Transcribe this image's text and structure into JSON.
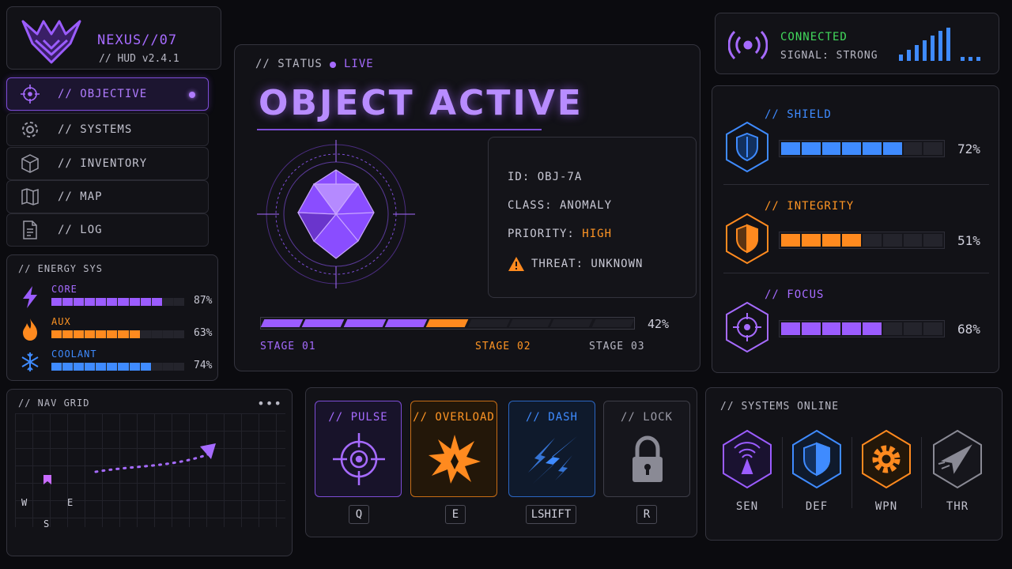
{
  "brand": {
    "title": "NEXUS//07",
    "version": "// HUD v2.4.1"
  },
  "nav": {
    "items": [
      {
        "label": "// OBJECTIVE",
        "icon": "crosshair-icon",
        "active": true
      },
      {
        "label": "// SYSTEMS",
        "icon": "gear-icon",
        "active": false
      },
      {
        "label": "// INVENTORY",
        "icon": "cube-icon",
        "active": false
      },
      {
        "label": "// MAP",
        "icon": "map-icon",
        "active": false
      },
      {
        "label": "// LOG",
        "icon": "document-icon",
        "active": false
      }
    ]
  },
  "energy": {
    "title": "// ENERGY SYS",
    "rows": [
      {
        "name": "CORE",
        "value": "87%",
        "level": 0.87,
        "color": "#9b5cff",
        "icon": "lightning-icon"
      },
      {
        "name": "AUX",
        "value": "63%",
        "level": 0.63,
        "color": "#ff8a1f",
        "icon": "flame-icon"
      },
      {
        "name": "COOLANT",
        "value": "74%",
        "level": 0.74,
        "color": "#3f8bff",
        "icon": "snowflake-icon"
      }
    ]
  },
  "status": {
    "header": "// STATUS",
    "live": "LIVE",
    "title": "OBJECT ACTIVE",
    "id": "ID: OBJ-7A",
    "class": "CLASS: ANOMALY",
    "priority_label": "PRIORITY:",
    "priority_value": "HIGH",
    "threat": "THREAT: UNKNOWN",
    "progress": {
      "value": "42%",
      "level": 0.42
    },
    "stages": [
      "STAGE 01",
      "STAGE 02",
      "STAGE 03"
    ]
  },
  "connection": {
    "status": "CONNECTED",
    "signal": "SIGNAL: STRONG"
  },
  "stats": [
    {
      "name": "// SHIELD",
      "value": "72%",
      "level": 0.72,
      "color": "#3f8bff",
      "icon": "shield-icon"
    },
    {
      "name": "// INTEGRITY",
      "value": "51%",
      "level": 0.51,
      "color": "#ff8a1f",
      "icon": "shield-icon"
    },
    {
      "name": "// FOCUS",
      "value": "68%",
      "level": 0.68,
      "color": "#9b5cff",
      "icon": "crosshair-icon"
    }
  ],
  "navgrid": {
    "title": "// NAV GRID",
    "compass": {
      "w": "W",
      "e": "E",
      "s": "S"
    }
  },
  "abilities": [
    {
      "name": "// PULSE",
      "key": "Q",
      "color": "#9b5cff",
      "icon": "crosshair-icon"
    },
    {
      "name": "// OVERLOAD",
      "key": "E",
      "color": "#ff8a1f",
      "icon": "explosion-icon"
    },
    {
      "name": "// DASH",
      "key": "LSHIFT",
      "color": "#3f8bff",
      "icon": "dash-icon"
    },
    {
      "name": "// LOCK",
      "key": "R",
      "color": "#8a8a95",
      "icon": "lock-icon"
    }
  ],
  "systems": {
    "title": "// SYSTEMS ONLINE",
    "items": [
      {
        "name": "SEN",
        "color": "#9b5cff",
        "icon": "sensor-icon"
      },
      {
        "name": "DEF",
        "color": "#3f8bff",
        "icon": "shield-icon"
      },
      {
        "name": "WPN",
        "color": "#ff8a1f",
        "icon": "gear-icon"
      },
      {
        "name": "THR",
        "color": "#8a8a95",
        "icon": "thruster-icon"
      }
    ]
  }
}
